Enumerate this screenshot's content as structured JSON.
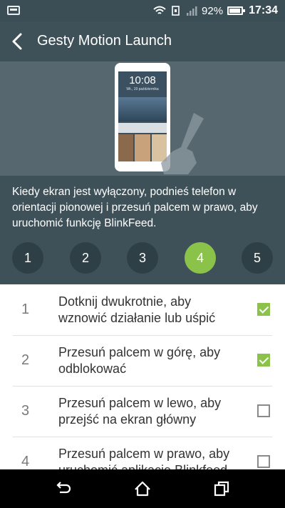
{
  "status_bar": {
    "battery_percent": "92%",
    "battery_level": 0.92,
    "time": "17:34",
    "icons": [
      "screenshot-icon",
      "wifi-icon",
      "sim-icon",
      "signal-icon",
      "battery-icon"
    ]
  },
  "header": {
    "title": "Gesty Motion Launch"
  },
  "illustration": {
    "clock": "10:08",
    "date": "Wt., 19 października"
  },
  "instructions": {
    "text": "Kiedy ekran jest wyłączony, podnieś telefon w orientacji pionowej i przesuń palcem w prawo, aby uruchomić funkcję BlinkFeed."
  },
  "steps": [
    {
      "label": "1",
      "active": false
    },
    {
      "label": "2",
      "active": false
    },
    {
      "label": "3",
      "active": false
    },
    {
      "label": "4",
      "active": true
    },
    {
      "label": "5",
      "active": false
    }
  ],
  "gestures": [
    {
      "num": "1",
      "text": "Dotknij dwukrotnie, aby wznowić działanie lub uśpić",
      "checked": true
    },
    {
      "num": "2",
      "text": "Przesuń palcem w górę, aby odblokować",
      "checked": true
    },
    {
      "num": "3",
      "text": "Przesuń palcem w lewo, aby przejść na ekran główny",
      "checked": false
    },
    {
      "num": "4",
      "text": "Przesuń palcem w prawo, aby uruchomić aplikację Blinkfeed",
      "checked": false
    }
  ],
  "colors": {
    "status_bar": "#3b4e56",
    "header": "#3e5159",
    "accent_green": "#8bc34a"
  }
}
